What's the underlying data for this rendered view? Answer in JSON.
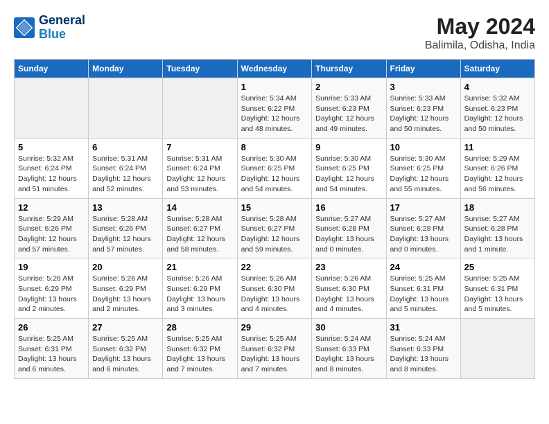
{
  "logo": {
    "line1": "General",
    "line2": "Blue"
  },
  "title": "May 2024",
  "subtitle": "Balimila, Odisha, India",
  "days_of_week": [
    "Sunday",
    "Monday",
    "Tuesday",
    "Wednesday",
    "Thursday",
    "Friday",
    "Saturday"
  ],
  "weeks": [
    [
      {
        "num": "",
        "info": ""
      },
      {
        "num": "",
        "info": ""
      },
      {
        "num": "",
        "info": ""
      },
      {
        "num": "1",
        "info": "Sunrise: 5:34 AM\nSunset: 6:22 PM\nDaylight: 12 hours\nand 48 minutes."
      },
      {
        "num": "2",
        "info": "Sunrise: 5:33 AM\nSunset: 6:23 PM\nDaylight: 12 hours\nand 49 minutes."
      },
      {
        "num": "3",
        "info": "Sunrise: 5:33 AM\nSunset: 6:23 PM\nDaylight: 12 hours\nand 50 minutes."
      },
      {
        "num": "4",
        "info": "Sunrise: 5:32 AM\nSunset: 6:23 PM\nDaylight: 12 hours\nand 50 minutes."
      }
    ],
    [
      {
        "num": "5",
        "info": "Sunrise: 5:32 AM\nSunset: 6:24 PM\nDaylight: 12 hours\nand 51 minutes."
      },
      {
        "num": "6",
        "info": "Sunrise: 5:31 AM\nSunset: 6:24 PM\nDaylight: 12 hours\nand 52 minutes."
      },
      {
        "num": "7",
        "info": "Sunrise: 5:31 AM\nSunset: 6:24 PM\nDaylight: 12 hours\nand 53 minutes."
      },
      {
        "num": "8",
        "info": "Sunrise: 5:30 AM\nSunset: 6:25 PM\nDaylight: 12 hours\nand 54 minutes."
      },
      {
        "num": "9",
        "info": "Sunrise: 5:30 AM\nSunset: 6:25 PM\nDaylight: 12 hours\nand 54 minutes."
      },
      {
        "num": "10",
        "info": "Sunrise: 5:30 AM\nSunset: 6:25 PM\nDaylight: 12 hours\nand 55 minutes."
      },
      {
        "num": "11",
        "info": "Sunrise: 5:29 AM\nSunset: 6:26 PM\nDaylight: 12 hours\nand 56 minutes."
      }
    ],
    [
      {
        "num": "12",
        "info": "Sunrise: 5:29 AM\nSunset: 6:26 PM\nDaylight: 12 hours\nand 57 minutes."
      },
      {
        "num": "13",
        "info": "Sunrise: 5:28 AM\nSunset: 6:26 PM\nDaylight: 12 hours\nand 57 minutes."
      },
      {
        "num": "14",
        "info": "Sunrise: 5:28 AM\nSunset: 6:27 PM\nDaylight: 12 hours\nand 58 minutes."
      },
      {
        "num": "15",
        "info": "Sunrise: 5:28 AM\nSunset: 6:27 PM\nDaylight: 12 hours\nand 59 minutes."
      },
      {
        "num": "16",
        "info": "Sunrise: 5:27 AM\nSunset: 6:28 PM\nDaylight: 13 hours\nand 0 minutes."
      },
      {
        "num": "17",
        "info": "Sunrise: 5:27 AM\nSunset: 6:28 PM\nDaylight: 13 hours\nand 0 minutes."
      },
      {
        "num": "18",
        "info": "Sunrise: 5:27 AM\nSunset: 6:28 PM\nDaylight: 13 hours\nand 1 minute."
      }
    ],
    [
      {
        "num": "19",
        "info": "Sunrise: 5:26 AM\nSunset: 6:29 PM\nDaylight: 13 hours\nand 2 minutes."
      },
      {
        "num": "20",
        "info": "Sunrise: 5:26 AM\nSunset: 6:29 PM\nDaylight: 13 hours\nand 2 minutes."
      },
      {
        "num": "21",
        "info": "Sunrise: 5:26 AM\nSunset: 6:29 PM\nDaylight: 13 hours\nand 3 minutes."
      },
      {
        "num": "22",
        "info": "Sunrise: 5:26 AM\nSunset: 6:30 PM\nDaylight: 13 hours\nand 4 minutes."
      },
      {
        "num": "23",
        "info": "Sunrise: 5:26 AM\nSunset: 6:30 PM\nDaylight: 13 hours\nand 4 minutes."
      },
      {
        "num": "24",
        "info": "Sunrise: 5:25 AM\nSunset: 6:31 PM\nDaylight: 13 hours\nand 5 minutes."
      },
      {
        "num": "25",
        "info": "Sunrise: 5:25 AM\nSunset: 6:31 PM\nDaylight: 13 hours\nand 5 minutes."
      }
    ],
    [
      {
        "num": "26",
        "info": "Sunrise: 5:25 AM\nSunset: 6:31 PM\nDaylight: 13 hours\nand 6 minutes."
      },
      {
        "num": "27",
        "info": "Sunrise: 5:25 AM\nSunset: 6:32 PM\nDaylight: 13 hours\nand 6 minutes."
      },
      {
        "num": "28",
        "info": "Sunrise: 5:25 AM\nSunset: 6:32 PM\nDaylight: 13 hours\nand 7 minutes."
      },
      {
        "num": "29",
        "info": "Sunrise: 5:25 AM\nSunset: 6:32 PM\nDaylight: 13 hours\nand 7 minutes."
      },
      {
        "num": "30",
        "info": "Sunrise: 5:24 AM\nSunset: 6:33 PM\nDaylight: 13 hours\nand 8 minutes."
      },
      {
        "num": "31",
        "info": "Sunrise: 5:24 AM\nSunset: 6:33 PM\nDaylight: 13 hours\nand 8 minutes."
      },
      {
        "num": "",
        "info": ""
      }
    ]
  ]
}
